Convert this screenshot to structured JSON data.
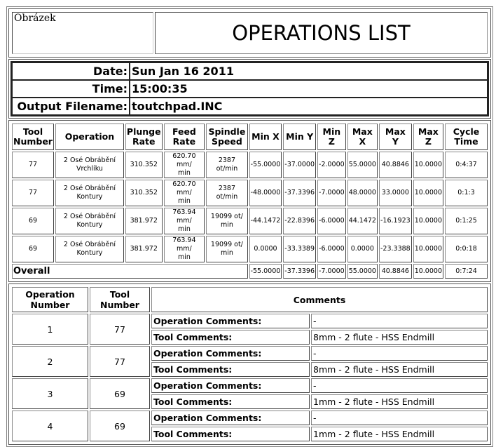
{
  "header": {
    "image_placeholder": "Obrázek",
    "title": "OPERATIONS LIST"
  },
  "info": {
    "date_label": "Date:",
    "date_value": "Sun Jan 16 2011",
    "time_label": "Time:",
    "time_value": "15:00:35",
    "filename_label": "Output Filename:",
    "filename_value": "toutchpad.INC"
  },
  "operations": {
    "columns": {
      "tool_1": "Tool",
      "tool_2": "Number",
      "operation": "Operation",
      "plunge_1": "Plunge",
      "plunge_2": "Rate",
      "feed_1": "Feed",
      "feed_2": "Rate",
      "spindle_1": "Spindle",
      "spindle_2": "Speed",
      "min_x": "Min X",
      "min_y": "Min Y",
      "min_z": "Min Z",
      "max_x_1": "Max",
      "max_x_2": "X",
      "max_y_1": "Max",
      "max_y_2": "Y",
      "max_z_1": "Max",
      "max_z_2": "Z",
      "cycle_1": "Cycle",
      "cycle_2": "Time"
    },
    "rows": [
      {
        "tool": "77",
        "op1": "2 Osé Obrábění",
        "op2": "Vrchlíku",
        "plunge": "310.352",
        "feed1": "620.70 mm/",
        "feed2": "min",
        "spindle1": "2387 ot/min",
        "spindle2": "",
        "min_x": "-55.0000",
        "min_y": "-37.0000",
        "min_z": "-2.0000",
        "max_x": "55.0000",
        "max_y": "40.8846",
        "max_z": "10.0000",
        "cycle": "0:4:37"
      },
      {
        "tool": "77",
        "op1": "2 Osé Obrábění",
        "op2": "Kontury",
        "plunge": "310.352",
        "feed1": "620.70 mm/",
        "feed2": "min",
        "spindle1": "2387 ot/min",
        "spindle2": "",
        "min_x": "-48.0000",
        "min_y": "-37.3396",
        "min_z": "-7.0000",
        "max_x": "48.0000",
        "max_y": "33.0000",
        "max_z": "10.0000",
        "cycle": "0:1:3"
      },
      {
        "tool": "69",
        "op1": "2 Osé Obrábění",
        "op2": "Kontury",
        "plunge": "381.972",
        "feed1": "763.94 mm/",
        "feed2": "min",
        "spindle1": "19099 ot/",
        "spindle2": "min",
        "min_x": "-44.1472",
        "min_y": "-22.8396",
        "min_z": "-6.0000",
        "max_x": "44.1472",
        "max_y": "-16.1923",
        "max_z": "10.0000",
        "cycle": "0:1:25"
      },
      {
        "tool": "69",
        "op1": "2 Osé Obrábění",
        "op2": "Kontury",
        "plunge": "381.972",
        "feed1": "763.94 mm/",
        "feed2": "min",
        "spindle1": "19099 ot/",
        "spindle2": "min",
        "min_x": "0.0000",
        "min_y": "-33.3389",
        "min_z": "-6.0000",
        "max_x": "0.0000",
        "max_y": "-23.3388",
        "max_z": "10.0000",
        "cycle": "0:0:18"
      }
    ],
    "overall": {
      "label": "Overall",
      "min_x": "-55.0000",
      "min_y": "-37.3396",
      "min_z": "-7.0000",
      "max_x": "55.0000",
      "max_y": "40.8846",
      "max_z": "10.0000",
      "cycle": "0:7:24"
    }
  },
  "comments": {
    "columns": {
      "op_1": "Operation",
      "op_2": "Number",
      "tool_1": "Tool",
      "tool_2": "Number",
      "comments": "Comments"
    },
    "op_comments_label": "Operation Comments:",
    "tool_comments_label": "Tool Comments:",
    "rows": [
      {
        "op": "1",
        "tool": "77",
        "op_comment": "-",
        "tool_comment": "8mm - 2 flute - HSS Endmill"
      },
      {
        "op": "2",
        "tool": "77",
        "op_comment": "-",
        "tool_comment": "8mm - 2 flute - HSS Endmill"
      },
      {
        "op": "3",
        "tool": "69",
        "op_comment": "-",
        "tool_comment": "1mm - 2 flute - HSS Endmill"
      },
      {
        "op": "4",
        "tool": "69",
        "op_comment": "-",
        "tool_comment": "1mm - 2 flute - HSS Endmill"
      }
    ]
  }
}
